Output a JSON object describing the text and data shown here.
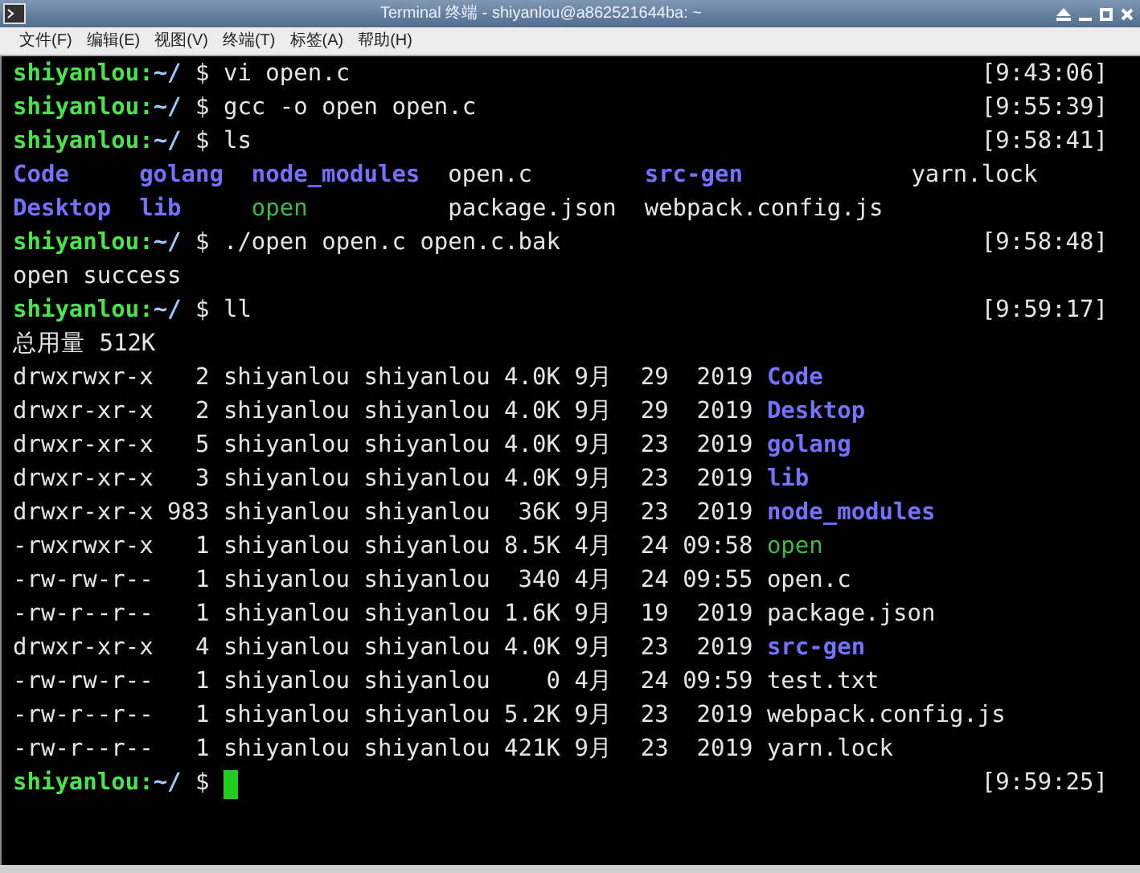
{
  "window": {
    "title": "Terminal 终端 - shiyanlou@a862521644ba: ~"
  },
  "menu": [
    "文件(F)",
    "编辑(E)",
    "视图(V)",
    "终端(T)",
    "标签(A)",
    "帮助(H)"
  ],
  "lines": [
    {
      "kind": "prompt",
      "user": "shiyanlou:",
      "path": "~/",
      "command": "$ vi open.c",
      "time": "[9:43:06]"
    },
    {
      "kind": "prompt",
      "user": "shiyanlou:",
      "path": "~/",
      "command": "$ gcc -o open open.c",
      "time": "[9:55:39]"
    },
    {
      "kind": "prompt",
      "user": "shiyanlou:",
      "path": "~/",
      "command": "$ ls",
      "time": "[9:58:41]"
    },
    {
      "kind": "listing",
      "columns": [
        [
          {
            "name": "Code",
            "kind": "dir"
          },
          {
            "name": "Desktop",
            "kind": "dir"
          }
        ],
        [
          {
            "name": "golang",
            "kind": "dir"
          },
          {
            "name": "lib",
            "kind": "dir"
          }
        ],
        [
          {
            "name": "node_modules",
            "kind": "dir"
          },
          {
            "name": "open",
            "kind": "exec"
          }
        ],
        [
          {
            "name": "open.c",
            "kind": "file"
          },
          {
            "name": "package.json",
            "kind": "file"
          }
        ],
        [
          {
            "name": "src-gen",
            "kind": "dir"
          },
          {
            "name": "webpack.config.js",
            "kind": "file"
          }
        ],
        [
          {
            "name": "yarn.lock",
            "kind": "file"
          }
        ]
      ]
    },
    {
      "kind": "prompt",
      "user": "shiyanlou:",
      "path": "~/",
      "command": "$ ./open open.c open.c.bak",
      "time": "[9:58:48]"
    },
    {
      "kind": "output",
      "text": "open success"
    },
    {
      "kind": "prompt",
      "user": "shiyanlou:",
      "path": "~/",
      "command": "$ ll",
      "time": "[9:59:17]"
    },
    {
      "kind": "output",
      "text": "总用量 512K"
    },
    {
      "kind": "entry",
      "info": "drwxrwxr-x   2 shiyanlou shiyanlou 4.0K 9月  29  2019",
      "file": {
        "name": "Code",
        "kind": "dir"
      }
    },
    {
      "kind": "entry",
      "info": "drwxr-xr-x   2 shiyanlou shiyanlou 4.0K 9月  29  2019",
      "file": {
        "name": "Desktop",
        "kind": "dir"
      }
    },
    {
      "kind": "entry",
      "info": "drwxr-xr-x   5 shiyanlou shiyanlou 4.0K 9月  23  2019",
      "file": {
        "name": "golang",
        "kind": "dir"
      }
    },
    {
      "kind": "entry",
      "info": "drwxr-xr-x   3 shiyanlou shiyanlou 4.0K 9月  23  2019",
      "file": {
        "name": "lib",
        "kind": "dir"
      }
    },
    {
      "kind": "entry",
      "info": "drwxr-xr-x 983 shiyanlou shiyanlou  36K 9月  23  2019",
      "file": {
        "name": "node_modules",
        "kind": "dir"
      }
    },
    {
      "kind": "entry",
      "info": "-rwxrwxr-x   1 shiyanlou shiyanlou 8.5K 4月  24 09:58",
      "file": {
        "name": "open",
        "kind": "exec"
      }
    },
    {
      "kind": "entry",
      "info": "-rw-rw-r--   1 shiyanlou shiyanlou  340 4月  24 09:55",
      "file": {
        "name": "open.c",
        "kind": "file"
      }
    },
    {
      "kind": "entry",
      "info": "-rw-r--r--   1 shiyanlou shiyanlou 1.6K 9月  19  2019",
      "file": {
        "name": "package.json",
        "kind": "file"
      }
    },
    {
      "kind": "entry",
      "info": "drwxr-xr-x   4 shiyanlou shiyanlou 4.0K 9月  23  2019",
      "file": {
        "name": "src-gen",
        "kind": "dir"
      }
    },
    {
      "kind": "entry",
      "info": "-rw-rw-r--   1 shiyanlou shiyanlou    0 4月  24 09:59",
      "file": {
        "name": "test.txt",
        "kind": "file"
      }
    },
    {
      "kind": "entry",
      "info": "-rw-r--r--   1 shiyanlou shiyanlou 5.2K 9月  23  2019",
      "file": {
        "name": "webpack.config.js",
        "kind": "file"
      }
    },
    {
      "kind": "entry",
      "info": "-rw-r--r--   1 shiyanlou shiyanlou 421K 9月  23  2019",
      "file": {
        "name": "yarn.lock",
        "kind": "file"
      }
    },
    {
      "kind": "prompt",
      "user": "shiyanlou:",
      "path": "~/",
      "command": "$",
      "time": "[9:59:25]",
      "cursor": true
    }
  ]
}
